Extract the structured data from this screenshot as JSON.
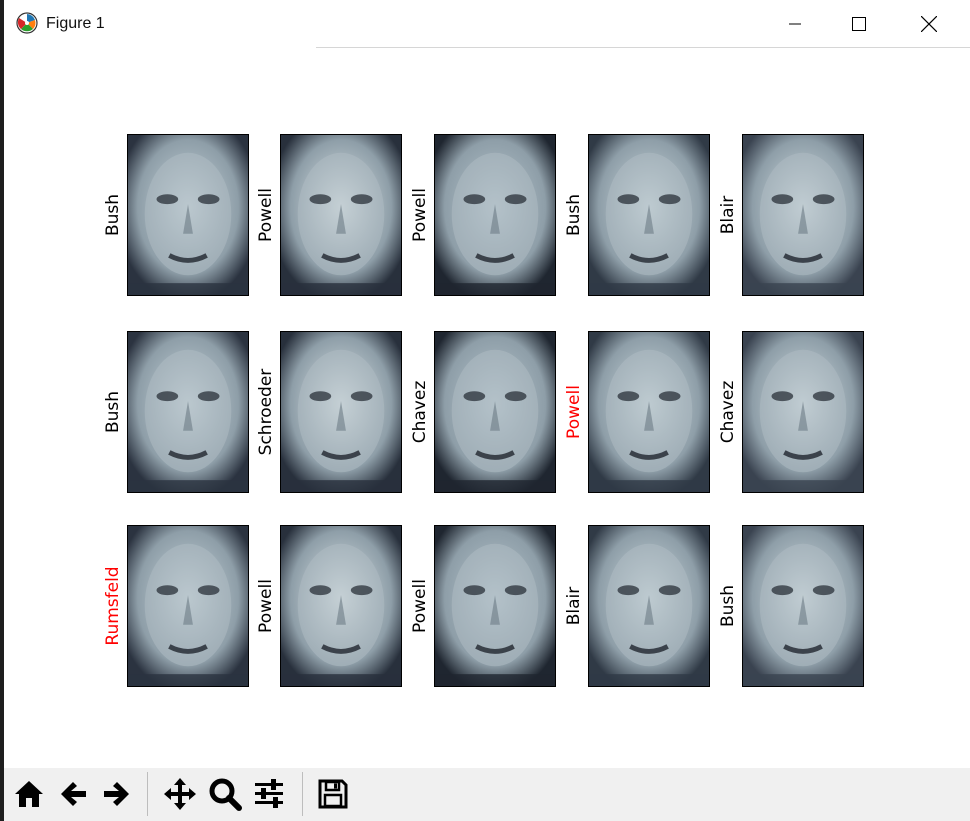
{
  "window": {
    "title": "Figure 1",
    "icon": "matplotlib-icon"
  },
  "window_controls": {
    "minimize_icon": "minimize-icon",
    "maximize_icon": "maximize-icon",
    "close_icon": "close-icon"
  },
  "faces": [
    {
      "label": "Bush",
      "label_color": "#000000"
    },
    {
      "label": "Powell",
      "label_color": "#000000"
    },
    {
      "label": "Powell",
      "label_color": "#000000"
    },
    {
      "label": "Bush",
      "label_color": "#000000"
    },
    {
      "label": "Blair",
      "label_color": "#000000"
    },
    {
      "label": "Bush",
      "label_color": "#000000"
    },
    {
      "label": "Schroeder",
      "label_color": "#000000"
    },
    {
      "label": "Chavez",
      "label_color": "#000000"
    },
    {
      "label": "Powell",
      "label_color": "#ff0000"
    },
    {
      "label": "Chavez",
      "label_color": "#000000"
    },
    {
      "label": "Rumsfeld",
      "label_color": "#ff0000"
    },
    {
      "label": "Powell",
      "label_color": "#000000"
    },
    {
      "label": "Powell",
      "label_color": "#000000"
    },
    {
      "label": "Blair",
      "label_color": "#000000"
    },
    {
      "label": "Bush",
      "label_color": "#000000"
    }
  ],
  "toolbar": {
    "buttons": [
      {
        "name": "home-button",
        "icon": "home-icon"
      },
      {
        "name": "back-button",
        "icon": "arrow-left-icon"
      },
      {
        "name": "forward-button",
        "icon": "arrow-right-icon"
      },
      {
        "name": "pan-button",
        "icon": "move-icon"
      },
      {
        "name": "zoom-button",
        "icon": "magnifier-icon"
      },
      {
        "name": "configure-subplots-button",
        "icon": "sliders-icon"
      },
      {
        "name": "save-button",
        "icon": "floppy-disk-icon"
      }
    ]
  },
  "colors": {
    "label_default": "#000000",
    "label_mismatch": "#ff0000",
    "toolbar_bg": "#f0f0f0",
    "colormap": "bone"
  }
}
